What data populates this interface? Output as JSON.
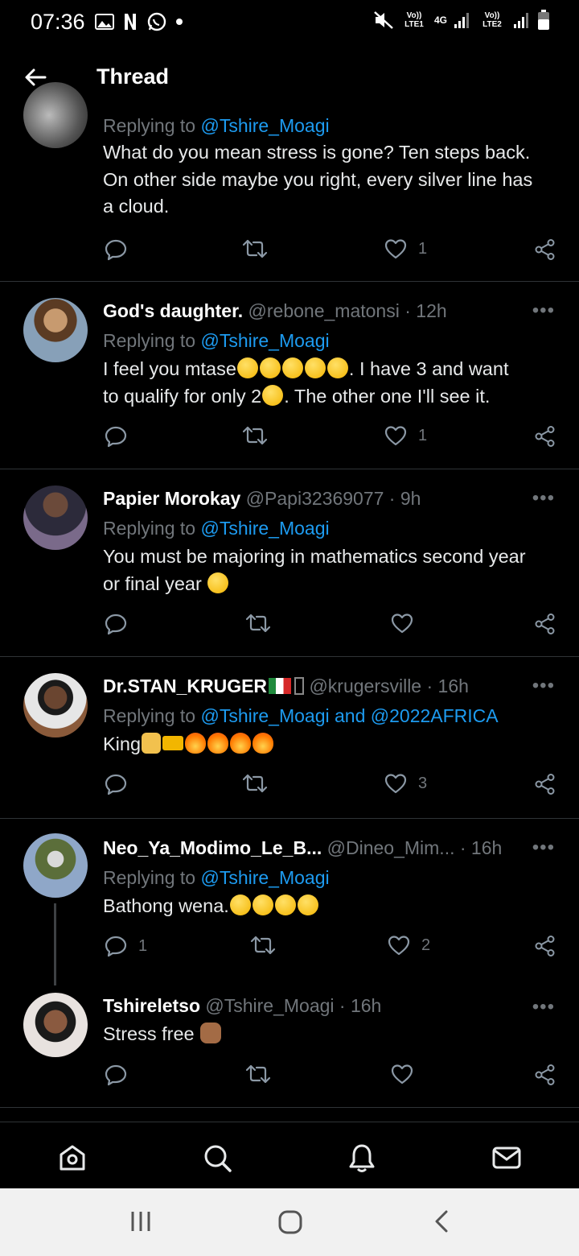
{
  "status": {
    "time": "07:36",
    "sim1_label": "Vo)) LTE1",
    "net_label": "4G",
    "sim2_label": "Vo)) LTE2"
  },
  "header": {
    "title": "Thread"
  },
  "tweets": [
    {
      "replying_prefix": "Replying to ",
      "replying_to": "@Tshire_Moagi",
      "text": "What do you mean stress is gone? Ten steps back. On other side maybe you right, every silver line has a cloud.",
      "text_lines": [
        "What do you mean stress is gone? Ten steps back.",
        "On other side maybe you right, every silver line has",
        "a cloud."
      ],
      "likes": "1"
    },
    {
      "name": "God's daughter.",
      "handle": "@rebone_matonsi",
      "time": "· 12h",
      "replying_prefix": "Replying to ",
      "replying_to": "@Tshire_Moagi",
      "text_line1_a": "I feel you mtase",
      "text_line1_b": ". I have 3 and want",
      "text_line2_a": "to qualify for only 2",
      "text_line2_b": ". The other one I'll see it.",
      "likes": "1"
    },
    {
      "name": "Papier Morokay",
      "handle": "@Papi32369077",
      "time": "· 9h",
      "replying_prefix": "Replying to ",
      "replying_to": "@Tshire_Moagi",
      "text_line1": "You must be majoring in mathematics second year",
      "text_line2": "or final year"
    },
    {
      "name": "Dr.STAN_KRUGER",
      "handle": "@krugersville",
      "time": "· 16h",
      "replying_prefix": "Replying to ",
      "replying_to": "@Tshire_Moagi and @2022AFRICA",
      "text": "King",
      "likes": "3"
    },
    {
      "name": "Neo_Ya_Modimo_Le_B...",
      "handle": "@Dineo_Mim...",
      "time": "· 16h",
      "replying_prefix": "Replying to ",
      "replying_to": "@Tshire_Moagi",
      "text": "Bathong wena.",
      "replies": "1",
      "likes": "2"
    },
    {
      "name": "Tshireletso",
      "handle": "@Tshire_Moagi",
      "time": "· 16h",
      "text": "Stress free"
    }
  ],
  "more_label": "•••",
  "colors": {
    "background": "#000000",
    "link": "#1d9bf0",
    "muted": "#71767b",
    "divider": "#2f3336"
  }
}
